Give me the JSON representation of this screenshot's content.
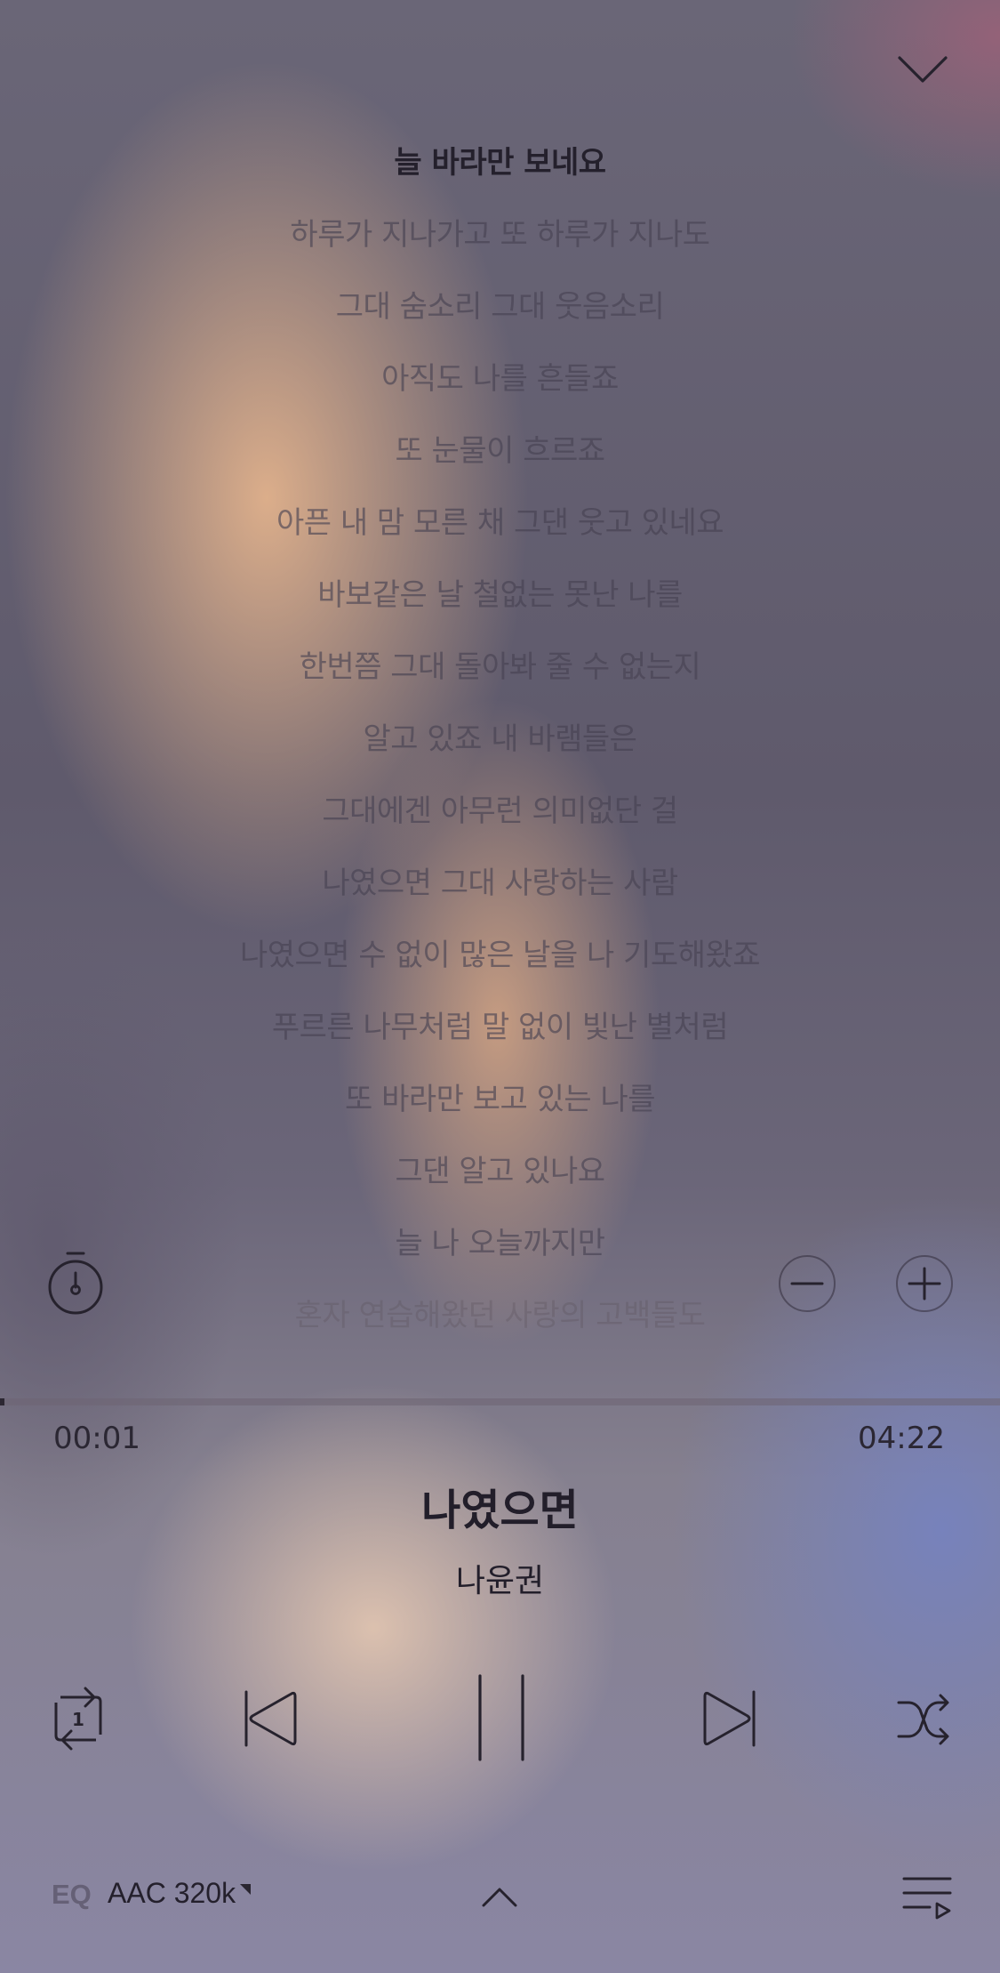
{
  "player": {
    "lyrics": [
      "늘 바라만 보네요",
      "하루가 지나가고 또 하루가 지나도",
      "그대 숨소리 그대 웃음소리",
      "아직도 나를 흔들죠",
      "또 눈물이 흐르죠",
      "아픈 내 맘 모른 채 그댄 웃고 있네요",
      "바보같은 날 철없는 못난 나를",
      "한번쯤 그대 돌아봐 줄 수 없는지",
      "알고 있죠 내 바램들은",
      "그대에겐 아무런 의미없단 걸",
      "나였으면 그대 사랑하는 사람",
      "나였으면 수 없이 많은 날을 나 기도해왔죠",
      "푸르른 나무처럼 말 없이 빛난 별처럼",
      "또 바라만 보고 있는 나를",
      "그댄 알고 있나요",
      "늘 나 오늘까지만",
      "혼자 연습해왔던 사랑의 고백들도"
    ],
    "current_lyric_index": 0,
    "elapsed": "00:01",
    "total": "04:22",
    "progress": 0.004,
    "title": "나였으면",
    "artist": "나윤권",
    "eq_label": "EQ",
    "quality": "AAC 320k",
    "repeat_mode_label": "1"
  },
  "icons": {
    "collapse": "chevron-down-icon",
    "timer": "stopwatch-icon",
    "font_decrease": "minus-circle-icon",
    "font_increase": "plus-circle-icon",
    "repeat": "repeat-one-icon",
    "previous": "skip-previous-icon",
    "pause": "pause-icon",
    "next": "skip-next-icon",
    "shuffle": "shuffle-icon",
    "expand": "chevron-up-icon",
    "playlist": "playlist-icon"
  },
  "colors": {
    "text_primary": "#221e2a",
    "lyric_dim": "#6a6272",
    "progress_fill": "#2c2732"
  }
}
